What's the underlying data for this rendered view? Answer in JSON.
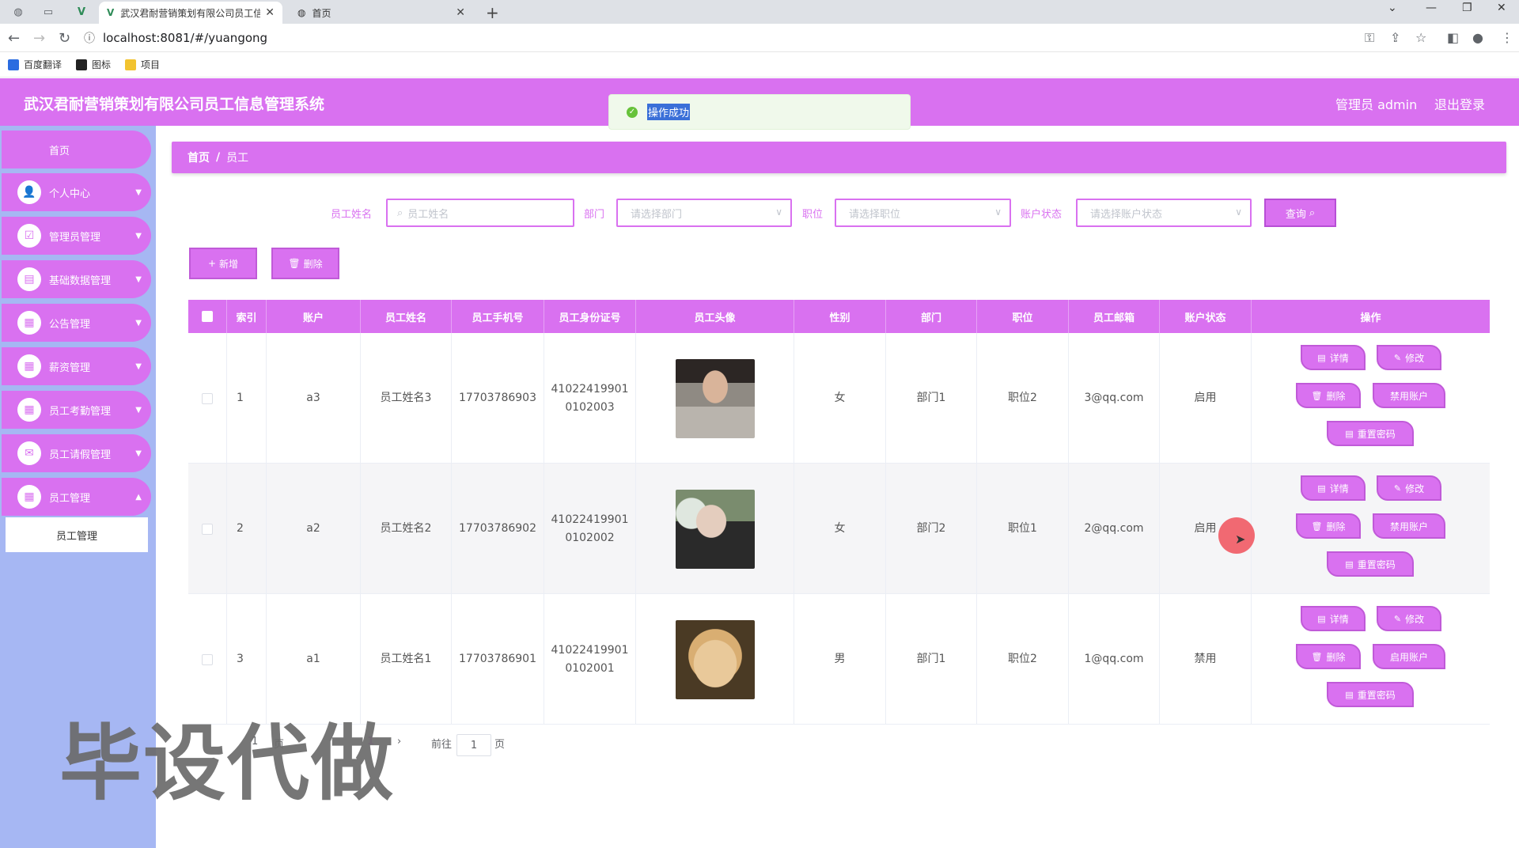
{
  "browser": {
    "tabs": [
      {
        "title": "武汉君耐营销策划有限公司员工信",
        "active": true
      },
      {
        "title": "首页",
        "active": false
      }
    ],
    "url": "localhost:8081/#/yuangong",
    "bookmarks": [
      {
        "label": "百度翻译",
        "color": "#2b6ce0"
      },
      {
        "label": "图标",
        "color": "#222222"
      },
      {
        "label": "项目",
        "color": "#f2c330"
      }
    ]
  },
  "header": {
    "title": "武汉君耐营销策划有限公司员工信息管理系统",
    "user": "管理员 admin",
    "logout": "退出登录",
    "bg_color": "#d971f0"
  },
  "toast": {
    "message": "操作成功"
  },
  "sidebar": {
    "home": "首页",
    "items": [
      {
        "label": "个人中心",
        "icon": "user-icon"
      },
      {
        "label": "管理员管理",
        "icon": "clipboard-check-icon"
      },
      {
        "label": "基础数据管理",
        "icon": "clipboard-icon"
      },
      {
        "label": "公告管理",
        "icon": "grid-icon"
      },
      {
        "label": "薪资管理",
        "icon": "grid-icon"
      },
      {
        "label": "员工考勤管理",
        "icon": "grid-icon"
      },
      {
        "label": "员工请假管理",
        "icon": "chat-icon"
      },
      {
        "label": "员工管理",
        "icon": "grid-icon"
      }
    ],
    "submenu": "员工管理",
    "bg_color": "#a6b7f3"
  },
  "breadcrumb": {
    "home": "首页",
    "separator": "/",
    "current": "员工"
  },
  "search": {
    "name_label": "员工姓名",
    "name_placeholder": "员工姓名",
    "dept_label": "部门",
    "dept_placeholder": "请选择部门",
    "pos_label": "职位",
    "pos_placeholder": "请选择职位",
    "status_label": "账户状态",
    "status_placeholder": "请选择账户状态",
    "query": "查询"
  },
  "toolbar": {
    "add": "新增",
    "delete": "删除"
  },
  "table": {
    "headers": [
      "索引",
      "账户",
      "员工姓名",
      "员工手机号",
      "员工身份证号",
      "员工头像",
      "性别",
      "部门",
      "职位",
      "员工邮箱",
      "账户状态",
      "操作"
    ],
    "rows": [
      {
        "index": "1",
        "account": "a3",
        "name": "员工姓名3",
        "phone": "17703786903",
        "id_line1": "41022419901",
        "id_line2": "0102003",
        "gender": "女",
        "dept": "部门1",
        "position": "职位2",
        "email": "3@qq.com",
        "status": "启用",
        "toggle": "禁用账户"
      },
      {
        "index": "2",
        "account": "a2",
        "name": "员工姓名2",
        "phone": "17703786902",
        "id_line1": "41022419901",
        "id_line2": "0102002",
        "gender": "女",
        "dept": "部门2",
        "position": "职位1",
        "email": "2@qq.com",
        "status": "启用",
        "toggle": "禁用账户"
      },
      {
        "index": "3",
        "account": "a1",
        "name": "员工姓名1",
        "phone": "17703786901",
        "id_line1": "41022419901",
        "id_line2": "0102001",
        "gender": "男",
        "dept": "部门1",
        "position": "职位2",
        "email": "1@qq.com",
        "status": "禁用",
        "toggle": "启用账户"
      }
    ],
    "actions": {
      "detail": "详情",
      "edit": "修改",
      "delete": "删除",
      "reset": "重置密码"
    }
  },
  "pagination": {
    "per_page_partial": "1",
    "page_unit_partial": "页",
    "current_page": "1",
    "goto_label": "前往",
    "goto_value": "1",
    "goto_unit": "页"
  },
  "watermark": "毕设代做"
}
